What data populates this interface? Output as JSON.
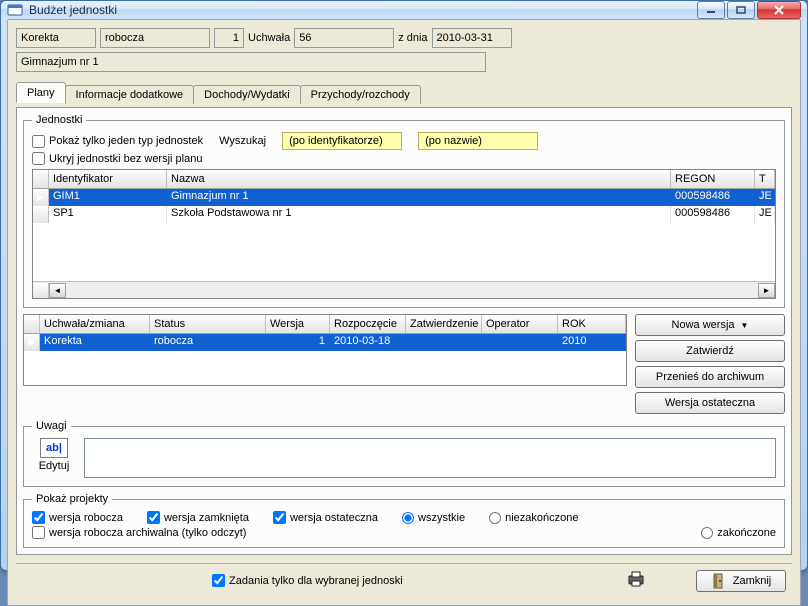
{
  "window": {
    "title": "Budżet jednostki"
  },
  "header": {
    "korekta": "Korekta",
    "status": "robocza",
    "wersja": "1",
    "uchwala_label": "Uchwała",
    "uchwala_num": "56",
    "zdnia_label": "z dnia",
    "zdnia_date": "2010-03-31",
    "jednostka": "Gimnazjum nr 1"
  },
  "tabs": {
    "plany": "Plany",
    "info": "Informacje dodatkowe",
    "dw": "Dochody/Wydatki",
    "pr": "Przychody/rozchody"
  },
  "jednostki": {
    "legend": "Jednostki",
    "chk_jeden_typ": "Pokaż tylko jeden typ jednostek",
    "chk_ukryj": "Ukryj jednostki bez wersji planu",
    "wyszukaj_label": "Wyszukaj",
    "search_by_id": "(po identyfikatorze)",
    "search_by_name": "(po nazwie)",
    "cols": {
      "id": "Identyfikator",
      "nazwa": "Nazwa",
      "regon": "REGON",
      "typ": "T"
    },
    "rows": [
      {
        "id": "GIM1",
        "nazwa": "Gimnazjum nr 1",
        "regon": "000598486",
        "typ": "JE"
      },
      {
        "id": "SP1",
        "nazwa": "Szkoła Podstawowa nr 1",
        "regon": "000598486",
        "typ": "JE"
      }
    ]
  },
  "wersje": {
    "cols": {
      "uz": "Uchwała/zmiana",
      "status": "Status",
      "wersja": "Wersja",
      "rozp": "Rozpoczęcie",
      "zatw": "Zatwierdzenie",
      "oper": "Operator",
      "rok": "ROK"
    },
    "rows": [
      {
        "uz": "Korekta",
        "status": "robocza",
        "wersja": "1",
        "rozp": "2010-03-18",
        "zatw": "",
        "oper": "",
        "rok": "2010"
      }
    ]
  },
  "buttons": {
    "nowa": "Nowa wersja",
    "zatw": "Zatwierdź",
    "archiwum": "Przenieś do archiwum",
    "ostateczna": "Wersja ostateczna"
  },
  "uwagi": {
    "legend": "Uwagi",
    "edytuj": "Edytuj",
    "icon_text": "ab|"
  },
  "projekty": {
    "legend": "Pokaż projekty",
    "chk_robocza": "wersja robocza",
    "chk_zamknieta": "wersja zamknięta",
    "chk_ostateczna": "wersja ostateczna",
    "chk_archiwalna": "wersja robocza archiwalna (tylko odczyt)",
    "r_wszystkie": "wszystkie",
    "r_zakonczone": "zakończone",
    "r_niezak": "niezakończone"
  },
  "footer": {
    "zadania": "Zadania tylko dla wybranej jednoski",
    "zamknij": "Zamknij"
  }
}
